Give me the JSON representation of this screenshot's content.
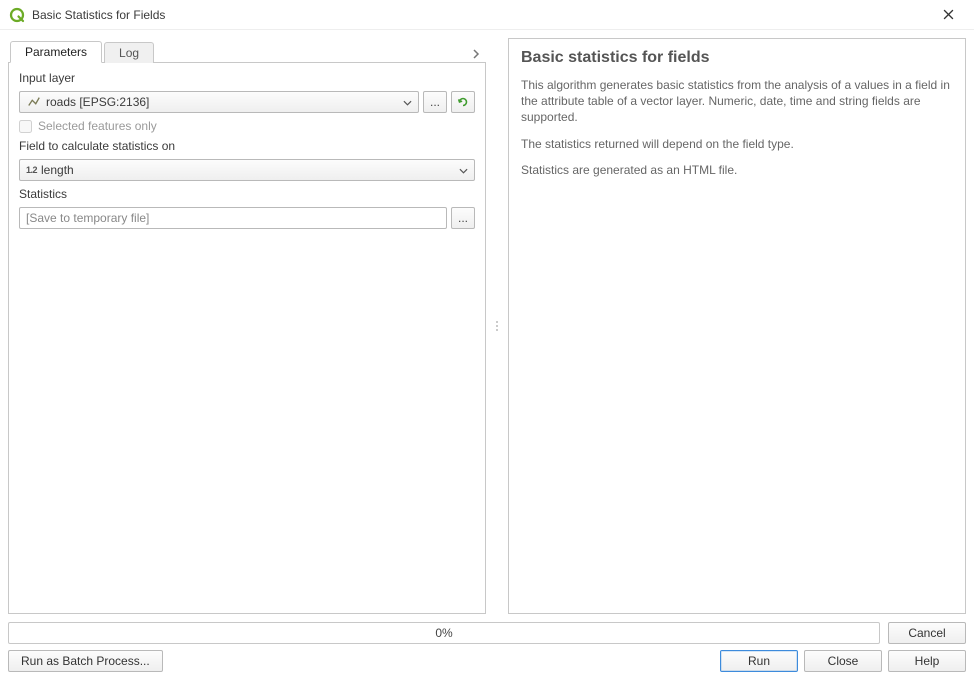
{
  "window": {
    "title": "Basic Statistics for Fields"
  },
  "tabs": {
    "parameters": "Parameters",
    "log": "Log"
  },
  "form": {
    "input_layer_label": "Input layer",
    "input_layer_value": "roads [EPSG:2136]",
    "selected_only_label": "Selected features only",
    "field_label": "Field to calculate statistics on",
    "field_type_tag": "1.2",
    "field_value": "length",
    "statistics_label": "Statistics",
    "statistics_placeholder": "[Save to temporary file]",
    "ellipsis": "..."
  },
  "help": {
    "title": "Basic statistics for fields",
    "p1": "This algorithm generates basic statistics from the analysis of a values in a field in the attribute table of a vector layer. Numeric, date, time and string fields are supported.",
    "p2": "The statistics returned will depend on the field type.",
    "p3": "Statistics are generated as an HTML file."
  },
  "progress": {
    "text": "0%"
  },
  "buttons": {
    "cancel": "Cancel",
    "batch": "Run as Batch Process...",
    "run": "Run",
    "close": "Close",
    "help": "Help"
  }
}
